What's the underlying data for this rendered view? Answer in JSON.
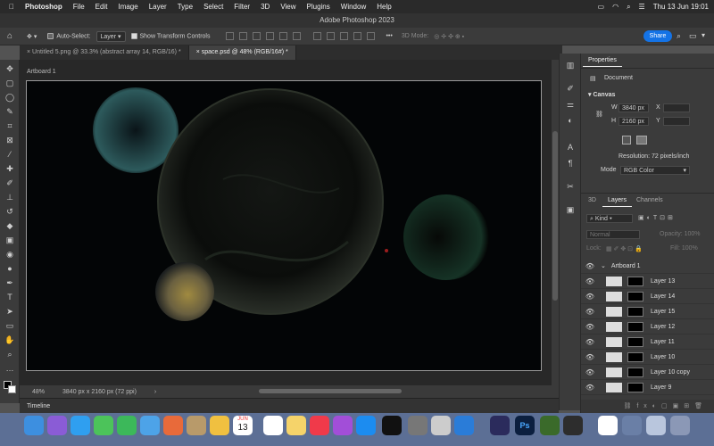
{
  "menubar": {
    "apple": "",
    "items": [
      "Photoshop",
      "File",
      "Edit",
      "Image",
      "Layer",
      "Type",
      "Select",
      "Filter",
      "3D",
      "View",
      "Plugins",
      "Window",
      "Help"
    ],
    "clock": "Thu 13 Jun  19:01"
  },
  "window_title": "Adobe Photoshop 2023",
  "options": {
    "auto_select": "Auto-Select:",
    "auto_select_value": "Layer",
    "show_transform": "Show Transform Controls",
    "mode_3d": "3D Mode:",
    "share": "Share"
  },
  "tabs": [
    {
      "label": "Untitled 5.png @ 33.3% (abstract array 14, RGB/16) *"
    },
    {
      "label": "space.psd @ 48% (RGB/16#) *"
    }
  ],
  "artboard_label": "Artboard 1",
  "status": {
    "zoom": "48%",
    "dims": "3840 px x 2160 px (72 ppi)"
  },
  "timeline_label": "Timeline",
  "properties": {
    "tab": "Properties",
    "document": "Document",
    "canvas_heading": "Canvas",
    "w_label": "W",
    "w_value": "3840 px",
    "h_label": "H",
    "h_value": "2160 px",
    "x_label": "X",
    "y_label": "Y",
    "resolution": "Resolution: 72 pixels/inch",
    "mode_label": "Mode",
    "mode_value": "RGB Color"
  },
  "layers_panel": {
    "tabs": [
      "3D",
      "Layers",
      "Channels"
    ],
    "kind": "Kind",
    "blend": "Normal",
    "opacity": "Opacity: 100%",
    "lock": "Lock:",
    "fill": "Fill: 100%",
    "group": "Artboard 1",
    "layers": [
      "Layer 13",
      "Layer 14",
      "Layer 15",
      "Layer 12",
      "Layer 11",
      "Layer 10",
      "Layer 10 copy",
      "Layer 9"
    ]
  },
  "dock": {
    "calendar_month": "JUN",
    "calendar_day": "13"
  }
}
